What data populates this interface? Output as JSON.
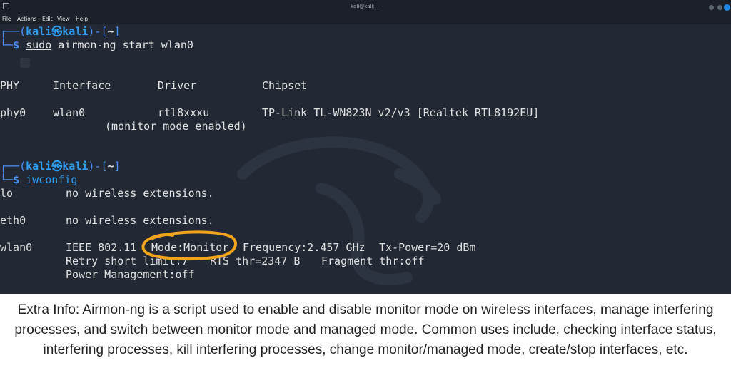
{
  "window": {
    "title": "kali@kali: ~",
    "menu": [
      "File",
      "Actions",
      "Edit",
      "View",
      "Help"
    ]
  },
  "terminal": {
    "prompt1": {
      "line1_prefix": "┌──(",
      "user": "kali",
      "at_symbol": "㉿",
      "host": "kali",
      "line1_mid": ")-[",
      "dir": "~",
      "line1_suffix": "]",
      "line2_prefix": "└─",
      "dollar": "$ ",
      "cmd_sudo": "sudo",
      "cmd_rest": " airmon-ng start wlan0"
    },
    "airmon_headers": {
      "phy": "PHY",
      "interface": "Interface",
      "driver": "Driver",
      "chipset": "Chipset"
    },
    "airmon_row": {
      "phy": "phy0",
      "interface": "wlan0",
      "driver": "rtl8xxxu",
      "chipset": "TP-Link TL-WN823N v2/v3 [Realtek RTL8192EU]",
      "note": "(monitor mode enabled)"
    },
    "prompt2": {
      "line1_prefix": "┌──(",
      "user": "kali",
      "at_symbol": "㉿",
      "host": "kali",
      "line1_mid": ")-[",
      "dir": "~",
      "line1_suffix": "]",
      "line2_prefix": "└─",
      "dollar": "$ ",
      "cmd": "iwconfig"
    },
    "iwconfig": {
      "lo_name": "lo",
      "lo_text": "no wireless extensions.",
      "eth_name": "eth0",
      "eth_text": "no wireless extensions.",
      "wlan_name": "wlan0",
      "wlan_std": "IEEE 802.11",
      "wlan_mode": "Mode:Monitor",
      "wlan_freq": "Frequency:2.457 GHz",
      "wlan_tx": "Tx-Power=20 dBm",
      "retry": "Retry short limit:7",
      "rts": "RTS thr=2347 B",
      "fragment": "Fragment thr:off",
      "power": "Power Management:off"
    }
  },
  "highlight_color": "#f2a51a",
  "caption": "Extra Info: Airmon-ng is a script used to enable and disable monitor mode on wireless interfaces, manage interfering processes, and switch between monitor mode and managed mode. Common uses include, checking interface status, interfering processes, kill interfering processes, change monitor/managed mode, create/stop interfaces, etc."
}
